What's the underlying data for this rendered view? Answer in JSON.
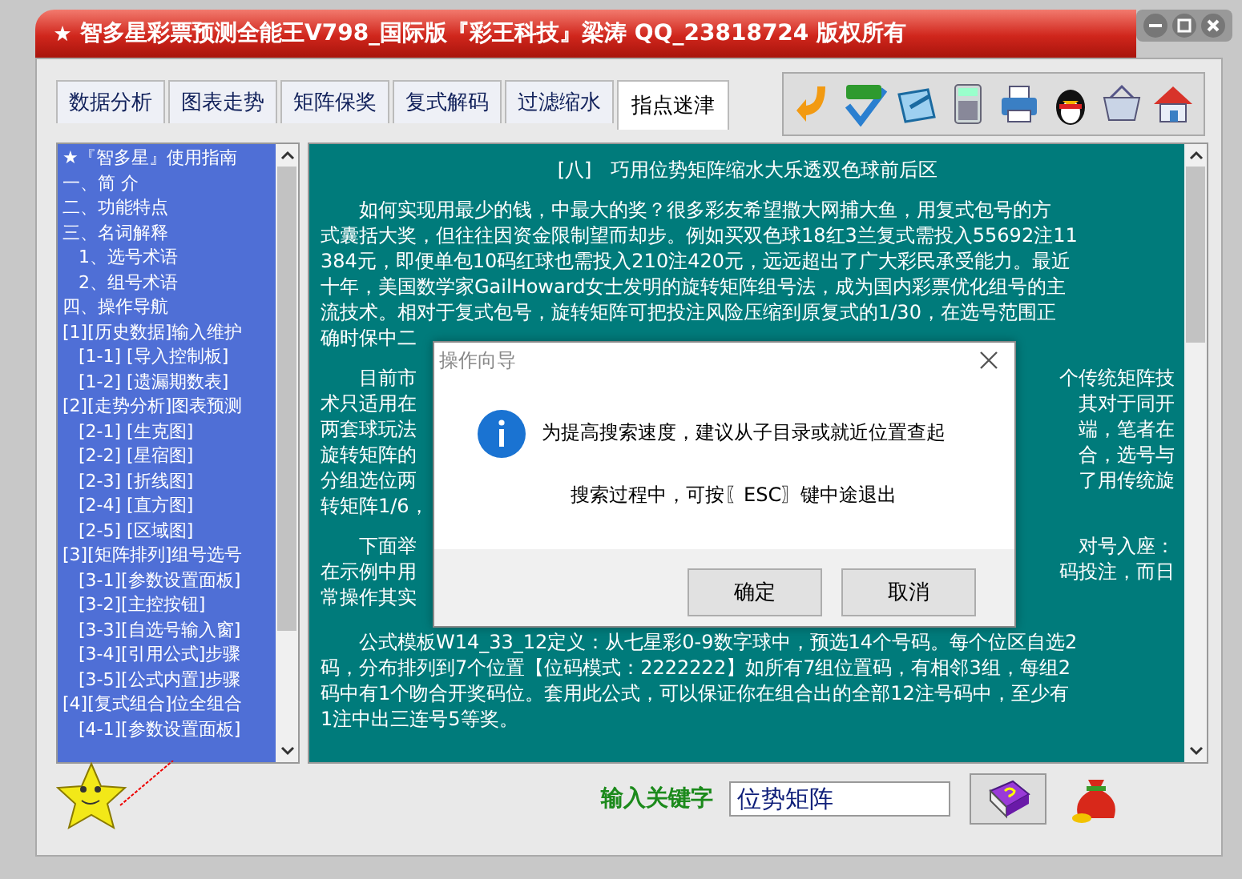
{
  "window": {
    "title": "智多星彩票预测全能王V798_国际版『彩王科技』梁涛 QQ_23818724 版权所有"
  },
  "tabs": [
    {
      "label": "数据分析",
      "selected": false
    },
    {
      "label": "图表走势",
      "selected": false
    },
    {
      "label": "矩阵保奖",
      "selected": false
    },
    {
      "label": "复式解码",
      "selected": false
    },
    {
      "label": "过滤缩水",
      "selected": false
    },
    {
      "label": "指点迷津",
      "selected": true
    }
  ],
  "sidebar": {
    "items": [
      {
        "label": "★『智多星』使用指南"
      },
      {
        "label": "一、简 介"
      },
      {
        "label": "二、功能特点"
      },
      {
        "label": "三、名词解释",
        "children": [
          {
            "label": "1、选号术语"
          },
          {
            "label": "2、组号术语"
          }
        ]
      },
      {
        "label": "四、操作导航"
      },
      {
        "label": "[1][历史数据]输入维护",
        "children": [
          {
            "label": "[1-1] [导入控制板]"
          },
          {
            "label": "[1-2] [遗漏期数表]"
          }
        ]
      },
      {
        "label": "[2][走势分析]图表预测",
        "children": [
          {
            "label": "[2-1] [生克图]"
          },
          {
            "label": "[2-2] [星宿图]"
          },
          {
            "label": "[2-3] [折线图]"
          },
          {
            "label": "[2-4] [直方图]"
          },
          {
            "label": "[2-5] [区域图]"
          }
        ]
      },
      {
        "label": "[3][矩阵排列]组号选号",
        "children": [
          {
            "label": "[3-1][参数设置面板]"
          },
          {
            "label": "[3-2][主控按钮]"
          },
          {
            "label": "[3-3][自选号输入窗]"
          },
          {
            "label": "[3-4][引用公式]步骤"
          },
          {
            "label": "[3-5][公式内置]步骤"
          }
        ]
      },
      {
        "label": "[4][复式组合]位全组合",
        "children": [
          {
            "label": "[4-1][参数设置面板]"
          }
        ]
      }
    ]
  },
  "content": {
    "title": "[八]　巧用位势矩阵缩水大乐透双色球前后区",
    "paragraphs": [
      {
        "lines": [
          {
            "left": "如何实现用最少的钱，中最大的奖？很多彩友希望撒大网捕大鱼，用复式包号的方"
          },
          {
            "left": "式囊括大奖，但往往因资金限制望而却步。例如买双色球18红3兰复式需投入55692注11"
          },
          {
            "left": "384元，即便单包10码红球也需投入210注420元，远远超出了广大彩民承受能力。最近"
          },
          {
            "left": "十年，美国数学家GailHoward女士发明的旋转矩阵组号法，成为国内彩票优化组号的主"
          },
          {
            "left": "流技术。相对于复式包号，旋转矩阵可把投注风险压缩到原复式的1/30，在选号范围正"
          },
          {
            "left": "确时保中二"
          }
        ]
      },
      {
        "lines": [
          {
            "left": "目前市",
            "right": "个传统矩阵技"
          },
          {
            "left": "术只适用在",
            "right": "其对于同开"
          },
          {
            "left": "两套球玩法",
            "right": "端，笔者在"
          },
          {
            "left": "旋转矩阵的",
            "right": "合，选号与"
          },
          {
            "left": "分组选位两",
            "right": "了用传统旋"
          },
          {
            "left": "转矩阵1/6，"
          }
        ]
      },
      {
        "lines": [
          {
            "left": "下面举",
            "right": "对号入座："
          },
          {
            "left": "在示例中用",
            "right": "码投注，而日"
          },
          {
            "left": "常操作其实"
          }
        ]
      },
      {
        "lines": [
          {
            "left": "公式模板W14_33_12定义：从七星彩0-9数字球中，预选14个号码。每个位区自选2"
          },
          {
            "left": "码，分布排列到7个位置【位码模式：2222222】如所有7组位置码，有相邻3组，每组2"
          },
          {
            "left": "码中有1个吻合开奖码位。套用此公式，可以保证你在组合出的全部12注号码中，至少有"
          },
          {
            "left": "1注中出三连号5等奖。"
          }
        ]
      }
    ]
  },
  "search": {
    "label": "输入关键字",
    "value": "位势矩阵"
  },
  "dialog": {
    "title": "操作向导",
    "messages": [
      "为提高搜索速度，建议从子目录或就近位置查起",
      "搜索过程中，可按〖ESC〗键中途退出"
    ],
    "buttons": [
      {
        "label": "确定"
      },
      {
        "label": "取消"
      }
    ]
  }
}
